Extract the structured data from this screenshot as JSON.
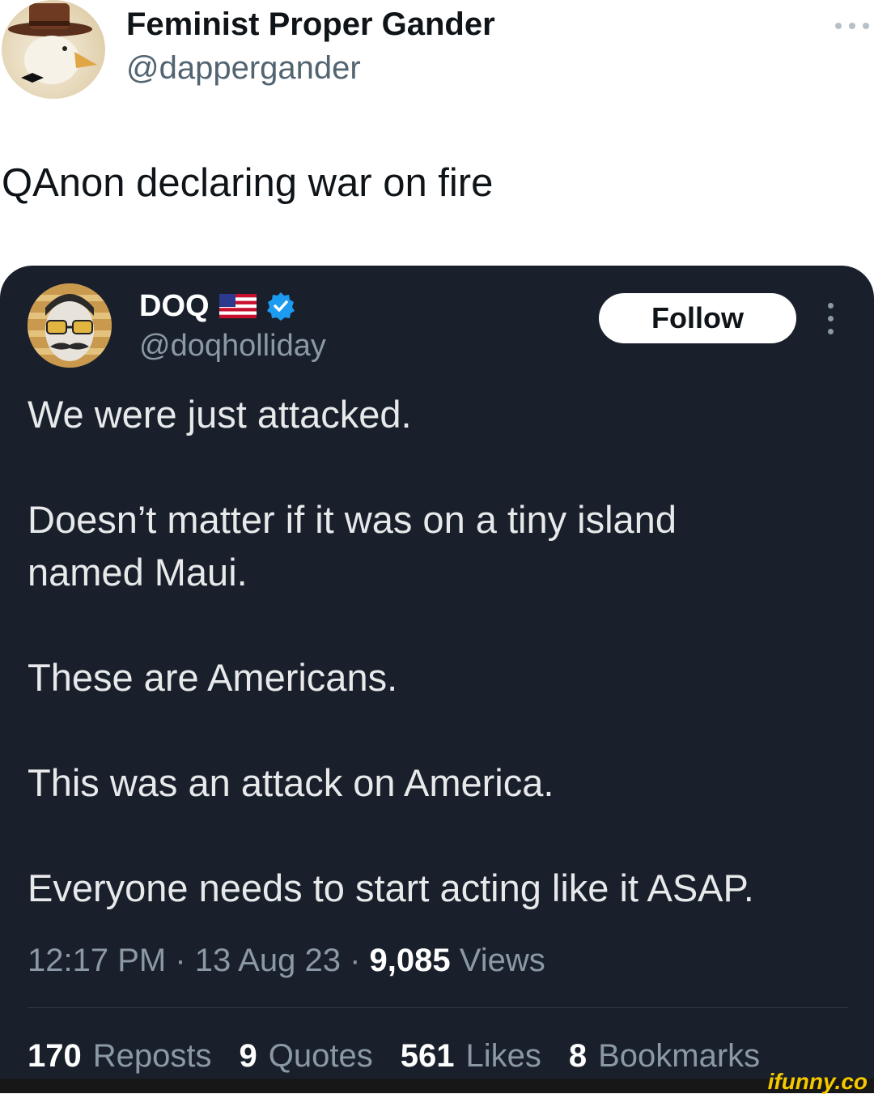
{
  "outer_tweet": {
    "author_name": "Feminist Proper Gander",
    "author_handle": "@dappergander",
    "text": "QAnon declaring war on fire"
  },
  "quoted_tweet": {
    "author_name": "DOQ",
    "author_handle": "@doqholliday",
    "flag_icon": "us-flag-icon",
    "verified_icon": "verified-badge-icon",
    "follow_label": "Follow",
    "lines": [
      "We were just attacked.",
      "Doesn’t matter if it was on a tiny island",
      "named Maui.",
      "These are Americans.",
      "This was an attack on America.",
      "Everyone needs to start acting like it ASAP."
    ],
    "meta": {
      "time": "12:17 PM",
      "date": "13 Aug 23",
      "views_count": "9,085",
      "views_label": "Views"
    },
    "stats": [
      {
        "count": "170",
        "label": "Reposts"
      },
      {
        "count": "9",
        "label": "Quotes"
      },
      {
        "count": "561",
        "label": "Likes"
      },
      {
        "count": "8",
        "label": "Bookmarks"
      }
    ]
  },
  "watermark": "ifunny.co",
  "colors": {
    "card_background": "#19202b",
    "verified_blue": "#1d9bf0",
    "watermark_yellow": "#f6c800"
  }
}
